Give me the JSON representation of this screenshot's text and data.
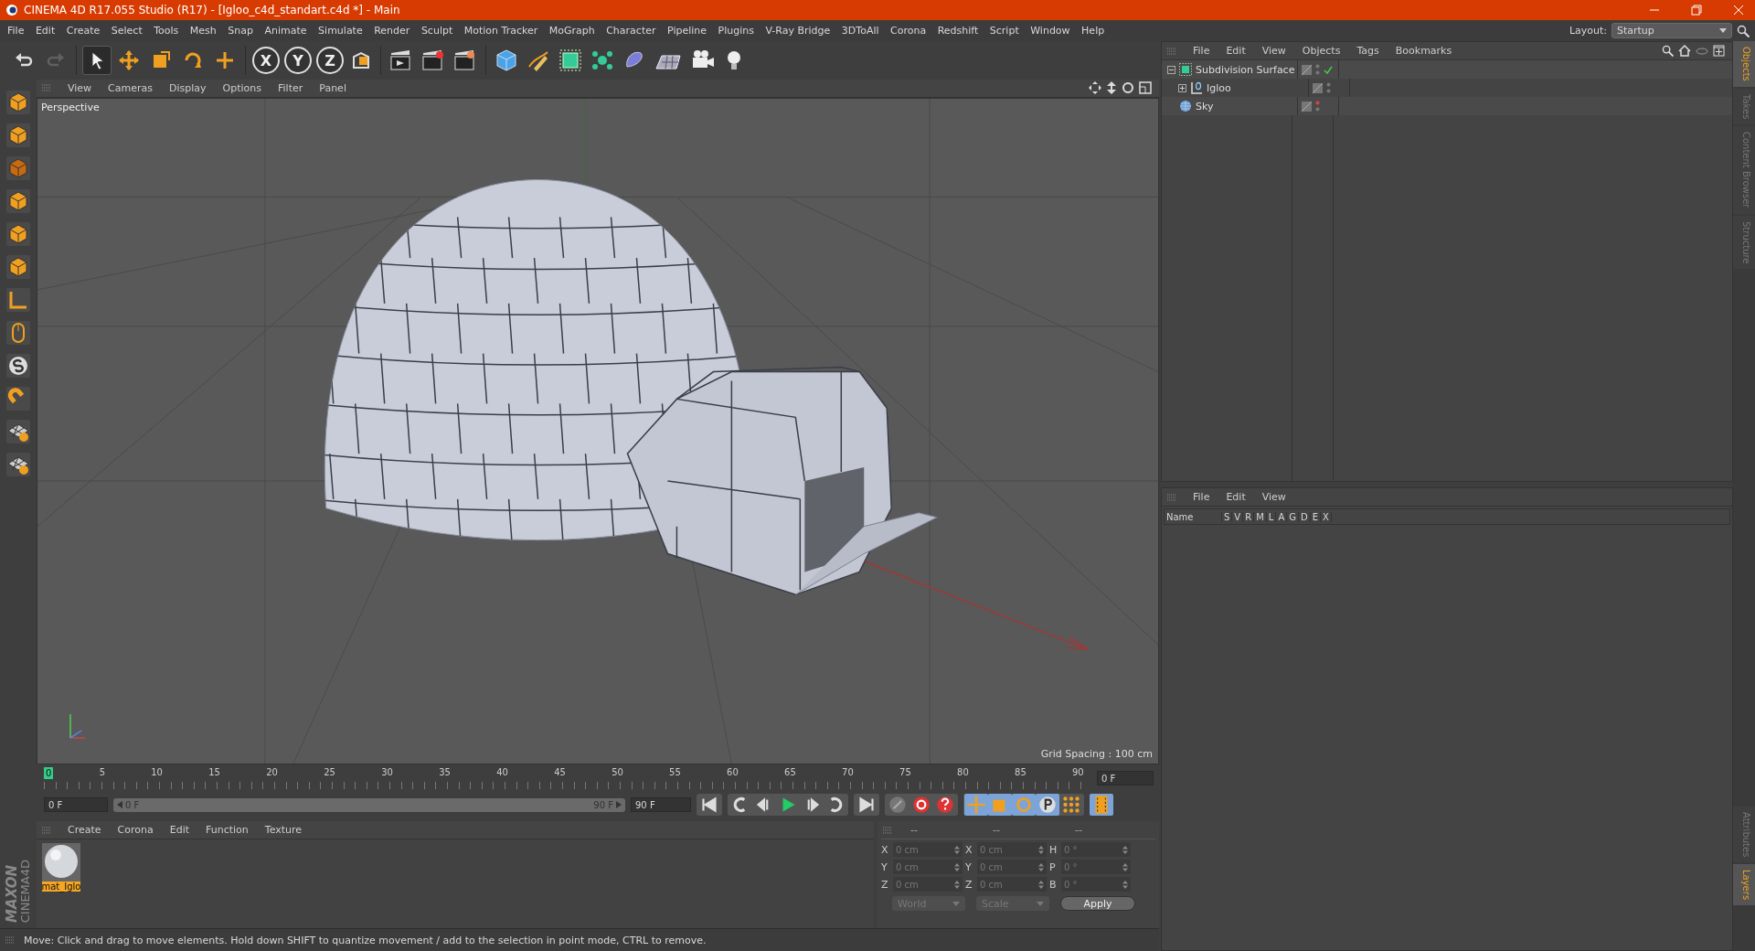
{
  "window": {
    "title": "CINEMA 4D R17.055 Studio (R17) - [Igloo_c4d_standart.c4d *] - Main"
  },
  "menu_bar": [
    "File",
    "Edit",
    "Create",
    "Select",
    "Tools",
    "Mesh",
    "Snap",
    "Animate",
    "Simulate",
    "Render",
    "Sculpt",
    "Motion Tracker",
    "MoGraph",
    "Character",
    "Pipeline",
    "Plugins",
    "V-Ray Bridge",
    "3DToAll",
    "Corona",
    "Redshift",
    "Script",
    "Window",
    "Help"
  ],
  "layout": {
    "label": "Layout:",
    "value": "Startup"
  },
  "tools": [
    {
      "selected": true
    },
    {
      "selected": false
    },
    {
      "selected": false
    },
    {
      "selected": false
    },
    {
      "selected": false
    }
  ],
  "axis_locks": [
    {
      "label": "X"
    },
    {
      "label": "Y"
    },
    {
      "label": "Z"
    }
  ],
  "viewport": {
    "menu": [
      "View",
      "Cameras",
      "Display",
      "Options",
      "Filter",
      "Panel"
    ],
    "camera_label": "Perspective",
    "grid_spacing": "Grid Spacing : 100 cm"
  },
  "timeline": {
    "playhead": "0",
    "ticks": [
      "5",
      "10",
      "15",
      "20",
      "25",
      "30",
      "35",
      "40",
      "45",
      "50",
      "55",
      "60",
      "65",
      "70",
      "75",
      "80",
      "85",
      "90"
    ],
    "current_frame": "0 F",
    "start_field": "0 F",
    "range_start": "0 F",
    "range_end": "90 F",
    "range_slider": {
      "level": 1
    },
    "end_field": "90 F",
    "key_filters": [
      {
        "on": true
      },
      {
        "on": true
      },
      {
        "on": true
      },
      {
        "on": true
      },
      {
        "on": false
      }
    ],
    "timeline_button": {
      "on": true
    }
  },
  "materials": {
    "menu": [
      "Create",
      "Corona",
      "Edit",
      "Function",
      "Texture"
    ],
    "items": [
      {
        "name": "mat_Iglo",
        "selected": true
      }
    ]
  },
  "coordinates": {
    "headers": [
      "--",
      "--",
      "--"
    ],
    "rows": [
      {
        "labels": [
          "X",
          "X",
          "H"
        ],
        "values": [
          "0 cm",
          "0 cm",
          "0 °"
        ]
      },
      {
        "labels": [
          "Y",
          "Y",
          "P"
        ],
        "values": [
          "0 cm",
          "0 cm",
          "0 °"
        ]
      },
      {
        "labels": [
          "Z",
          "Z",
          "B"
        ],
        "values": [
          "0 cm",
          "0 cm",
          "0 °"
        ]
      }
    ],
    "dropdowns": [
      "World",
      "Scale"
    ],
    "apply": "Apply"
  },
  "logo": {
    "brand": "MAXON",
    "product": "CINEMA4D"
  },
  "status_bar": "Move: Click and drag to move elements. Hold down SHIFT to quantize movement / add to the selection in point mode, CTRL to remove.",
  "objects_panel": {
    "menu": [
      "File",
      "Edit",
      "View",
      "Objects",
      "Tags",
      "Bookmarks"
    ],
    "objects": [
      {
        "name": "Subdivision Surface",
        "kind": "subdivision",
        "expanded": true,
        "enabled": true,
        "editor_hidden": false,
        "children": [
          {
            "name": "Igloo",
            "kind": "null",
            "expanded": false,
            "enabled": false,
            "editor_hidden": false
          }
        ]
      },
      {
        "name": "Sky",
        "kind": "sky",
        "enabled": false,
        "editor_hidden": true
      }
    ]
  },
  "layers_panel": {
    "menu": [
      "File",
      "Edit",
      "View"
    ],
    "columns": [
      "Name",
      "S",
      "V",
      "R",
      "M",
      "L",
      "A",
      "G",
      "D",
      "E",
      "X"
    ]
  },
  "side_tabs_top": [
    {
      "label": "Objects",
      "selected": true
    },
    {
      "label": "Takes",
      "selected": false
    },
    {
      "label": "Content Browser",
      "selected": false
    },
    {
      "label": "Structure",
      "selected": false
    }
  ],
  "side_tabs_bottom": [
    {
      "label": "Attributes",
      "selected": false
    },
    {
      "label": "Layers",
      "selected": true
    }
  ]
}
